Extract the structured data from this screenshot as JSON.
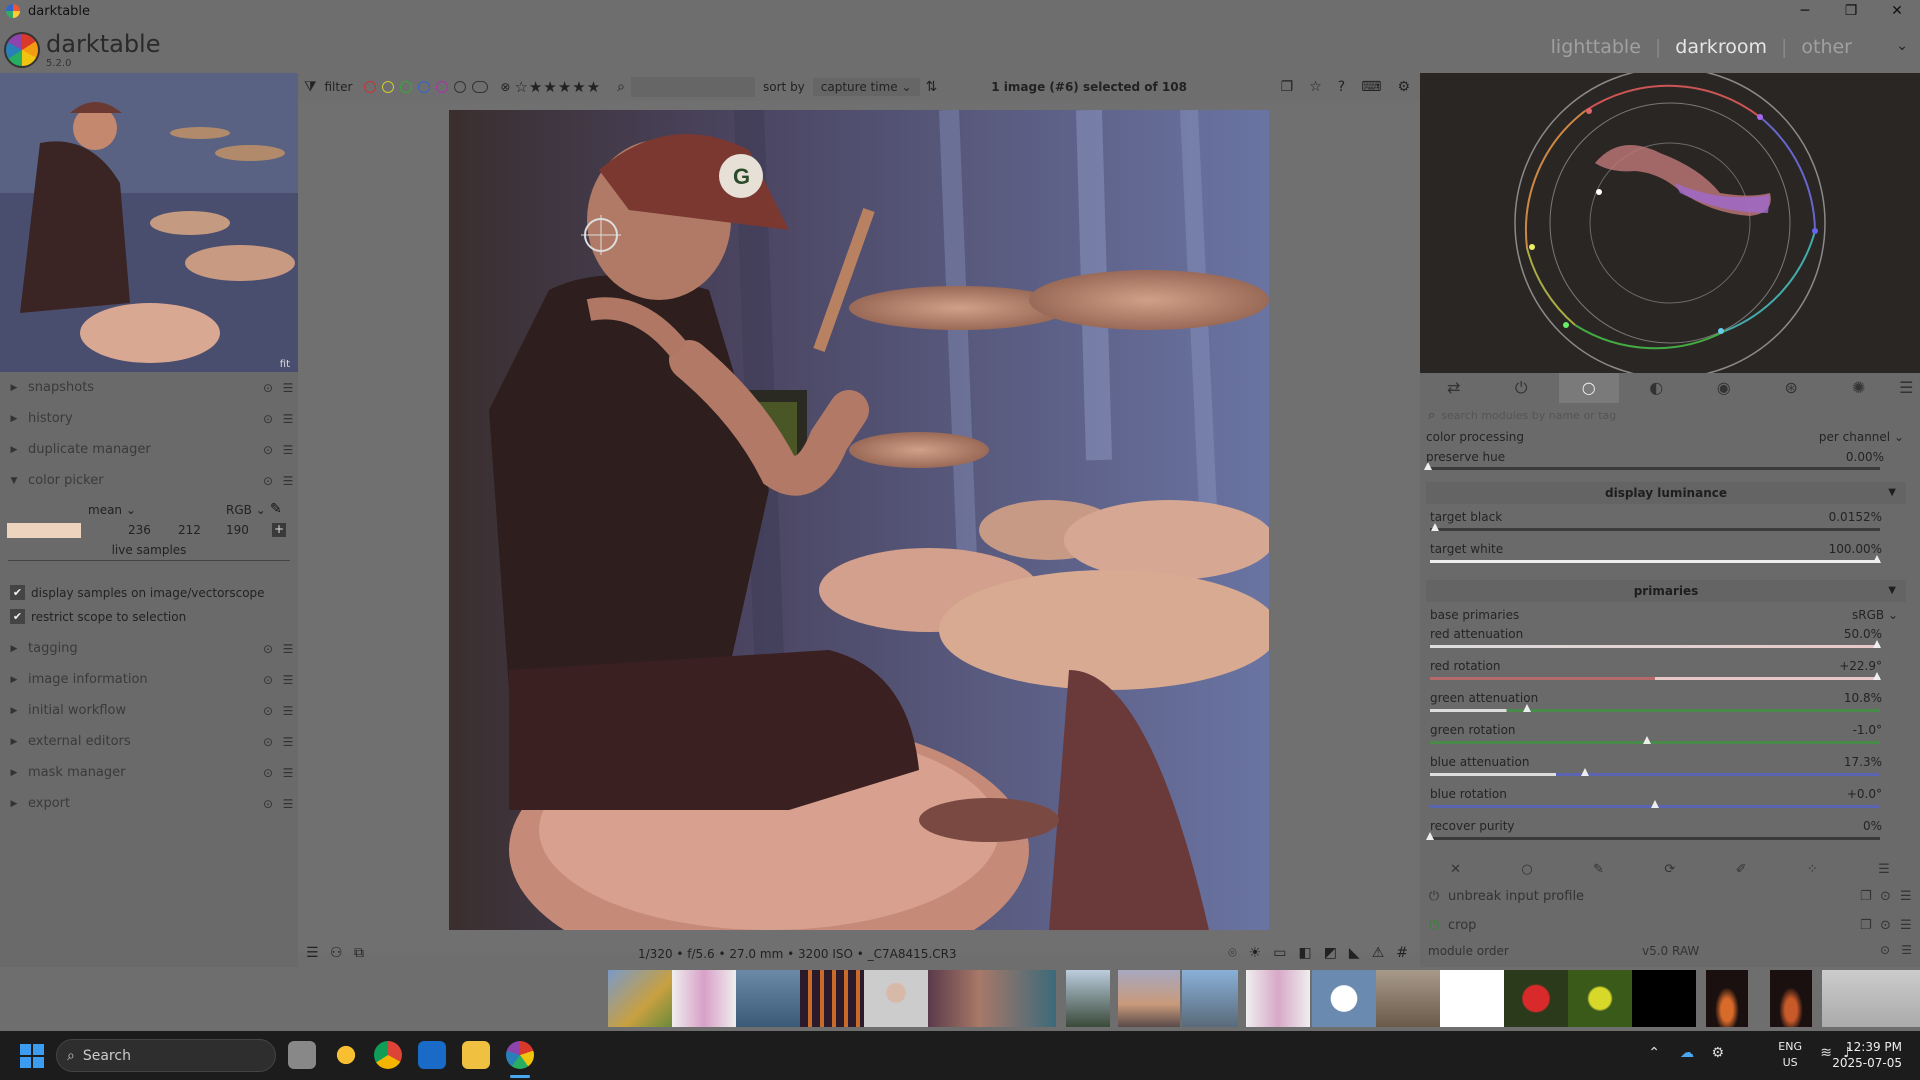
{
  "window": {
    "title": "darktable",
    "minimize": "─",
    "restore": "❐",
    "close": "✕"
  },
  "header": {
    "app_name": "darktable",
    "version": "5.2.0",
    "views": [
      "lighttable",
      "darkroom",
      "other"
    ],
    "active_view": "darkroom",
    "separator": "|",
    "chevron": "⌄"
  },
  "left_panel": {
    "thumb_label": "fit",
    "modules": {
      "snapshots": "snapshots",
      "history": "history",
      "duplicate_manager": "duplicate manager",
      "color_picker": "color picker",
      "tagging": "tagging",
      "image_information": "image information",
      "initial_workflow": "initial workflow",
      "external_editors": "external editors",
      "mask_manager": "mask manager",
      "export": "export"
    },
    "color_picker": {
      "mode": "mean",
      "space": "RGB",
      "r": "236",
      "g": "212",
      "b": "190",
      "swatch_color": "#ecd4be",
      "live_samples": "live samples",
      "opt_display": "display samples on image/vectorscope",
      "opt_restrict": "restrict scope to selection"
    }
  },
  "topbar": {
    "filter": "filter",
    "stars": "☆★★★★★",
    "sort_by": "sort by",
    "sort_value": "capture time",
    "selection": "1 image (#6) selected of 108"
  },
  "bottombar": {
    "exif": "1/320 • f/5.6 • 27.0 mm • 3200 ISO • _C7A8415.CR3"
  },
  "right_panel": {
    "search_placeholder": "search modules by name or tag",
    "color_processing": {
      "label": "color processing",
      "value": "per channel"
    },
    "preserve_hue": {
      "label": "preserve hue",
      "value": "0.00%"
    },
    "display_luminance": "display luminance",
    "target_black": {
      "label": "target black",
      "value": "0.0152%",
      "level": 0.0152
    },
    "target_white": {
      "label": "target white",
      "value": "100.00%",
      "level": 100
    },
    "primaries": "primaries",
    "base_primaries": {
      "label": "base primaries",
      "value": "sRGB"
    },
    "red_attenuation": {
      "label": "red attenuation",
      "value": "50.0%"
    },
    "red_rotation": {
      "label": "red rotation",
      "value": "+22.9°"
    },
    "green_attenuation": {
      "label": "green attenuation",
      "value": "10.8%"
    },
    "green_rotation": {
      "label": "green rotation",
      "value": "-1.0°"
    },
    "blue_attenuation": {
      "label": "blue attenuation",
      "value": "17.3%"
    },
    "blue_rotation": {
      "label": "blue rotation",
      "value": "+0.0°"
    },
    "recover_purity": {
      "label": "recover purity",
      "value": "0%"
    },
    "unbreak_input_profile": "unbreak input profile",
    "crop": "crop",
    "module_order": {
      "label": "module order",
      "value": "v5.0 RAW"
    }
  },
  "taskbar": {
    "search": "Search",
    "lang_1": "ENG",
    "lang_2": "US",
    "time": "12:39 PM",
    "date": "2025-07-05"
  },
  "colors": {
    "accent": "#e6e6e6",
    "panel": "#6a6a6a",
    "scope_bg": "#2a2624"
  }
}
